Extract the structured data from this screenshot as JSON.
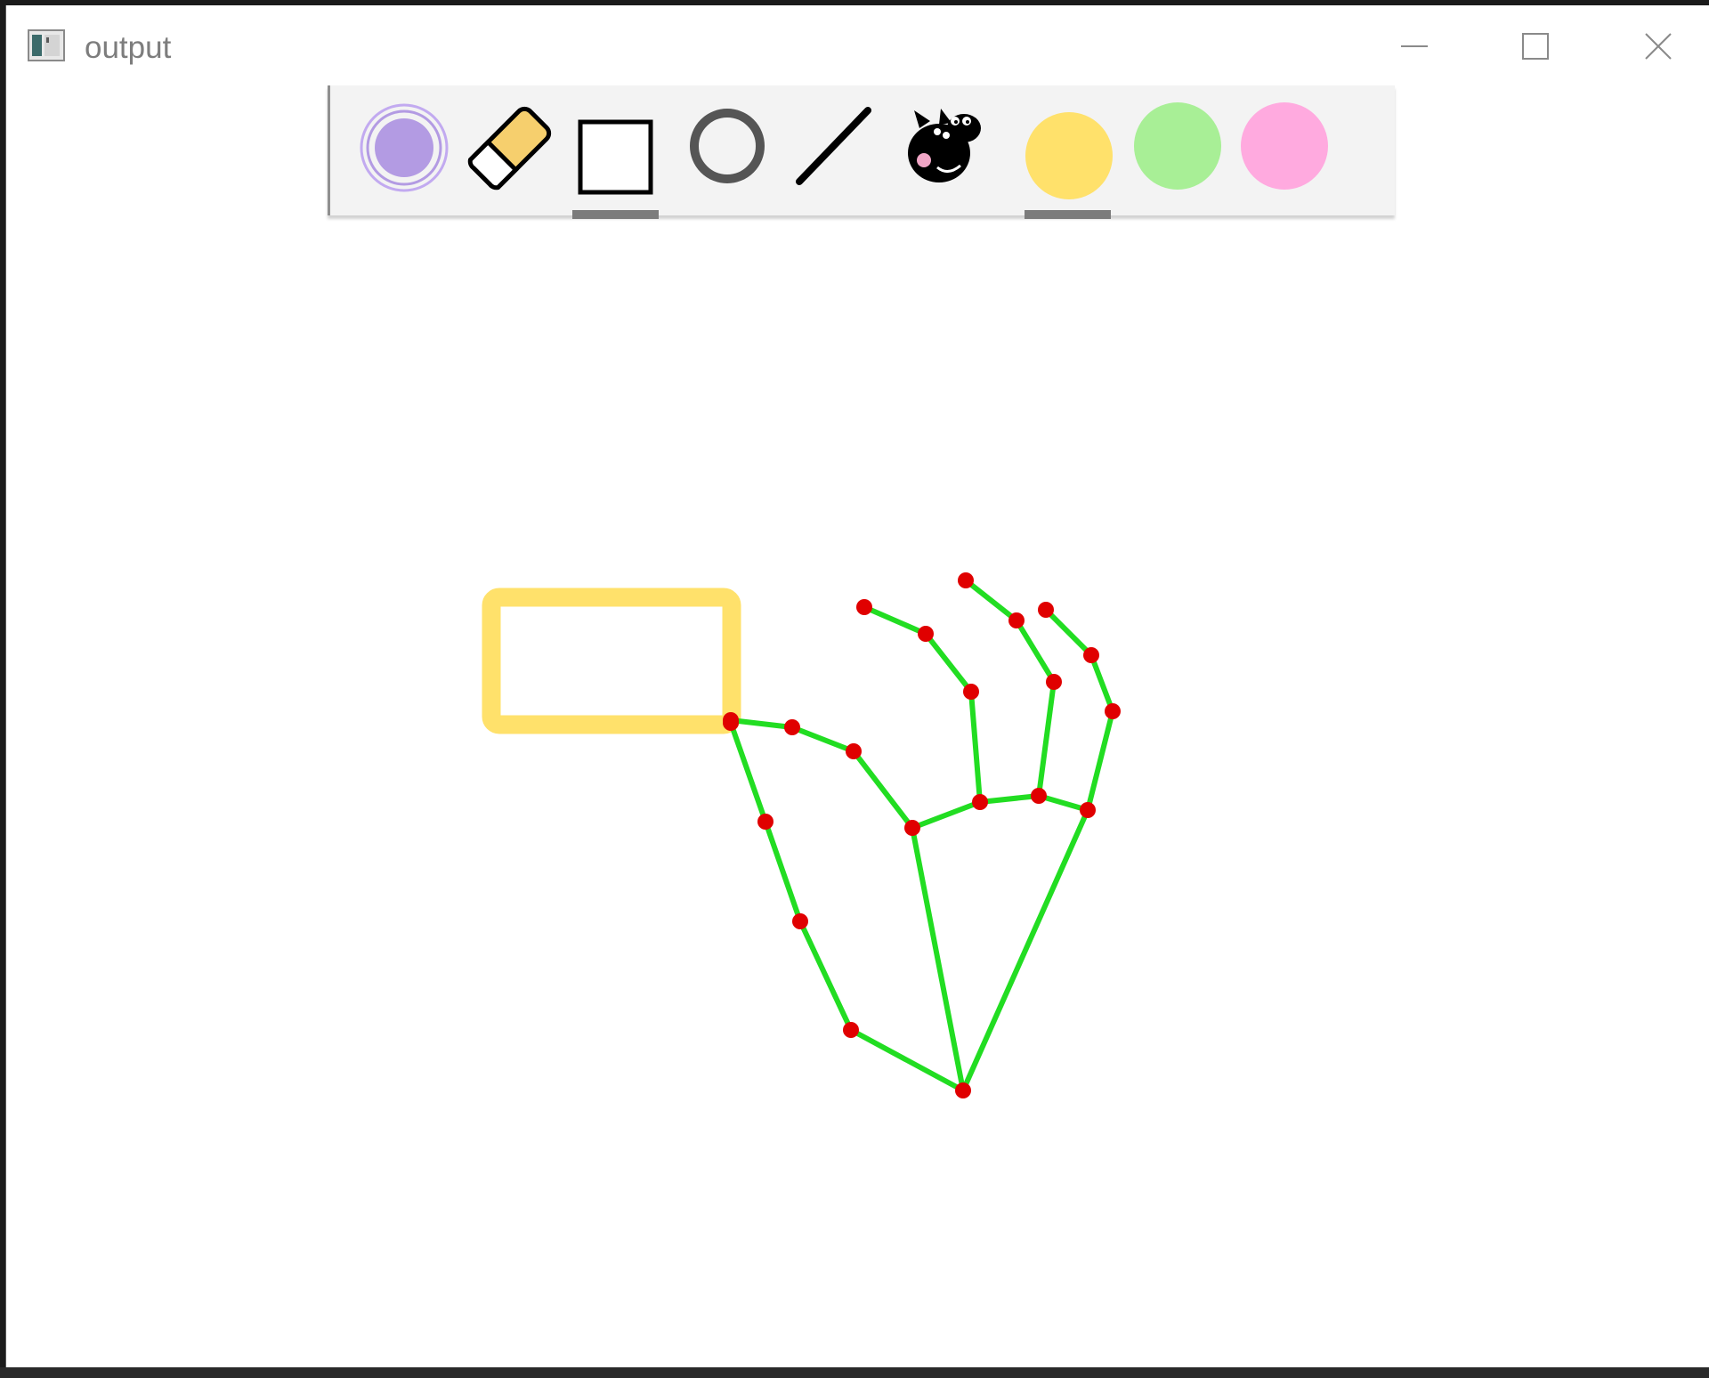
{
  "window": {
    "title": "output",
    "icon": "opencv-window-icon"
  },
  "window_controls": [
    {
      "name": "minimize-button",
      "icon": "minimize-icon"
    },
    {
      "name": "maximize-button",
      "icon": "maximize-icon"
    },
    {
      "name": "close-button",
      "icon": "close-icon"
    }
  ],
  "toolbar": {
    "tools": [
      {
        "name": "brush-tool",
        "icon": "concentric-circle-brush-icon",
        "color": "#b39be3"
      },
      {
        "name": "eraser-tool",
        "icon": "eraser-icon",
        "color": "#f6cf6d"
      },
      {
        "name": "rectangle-tool",
        "icon": "rectangle-icon",
        "selected": true
      },
      {
        "name": "circle-tool",
        "icon": "circle-icon"
      },
      {
        "name": "line-tool",
        "icon": "line-icon"
      },
      {
        "name": "stamp-tool",
        "icon": "peppa-pig-icon"
      }
    ],
    "colors": [
      {
        "name": "color-yellow",
        "hex": "#ffe16b",
        "selected": true
      },
      {
        "name": "color-green",
        "hex": "#a8ef96",
        "selected": false
      },
      {
        "name": "color-pink",
        "hex": "#ffaadf",
        "selected": false
      }
    ]
  },
  "canvas": {
    "drawn_shape": {
      "type": "rectangle",
      "color": "#ffe16b"
    },
    "hand_overlay": {
      "line_color": "#22dd22",
      "point_color": "#e00000"
    }
  }
}
